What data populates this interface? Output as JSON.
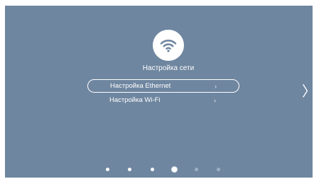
{
  "page": {
    "title": "Настройка сети",
    "icon": "wifi-icon",
    "background_color": "#6f86a0"
  },
  "menu": {
    "items": [
      {
        "label": "Настройка Ethernet",
        "chevron": "›",
        "selected": true
      },
      {
        "label": "Настройка Wi-Fi",
        "chevron": "›",
        "selected": false
      }
    ]
  },
  "navigation": {
    "next_arrow": "〉"
  },
  "pagination": {
    "total": 6,
    "current_index": 3
  }
}
